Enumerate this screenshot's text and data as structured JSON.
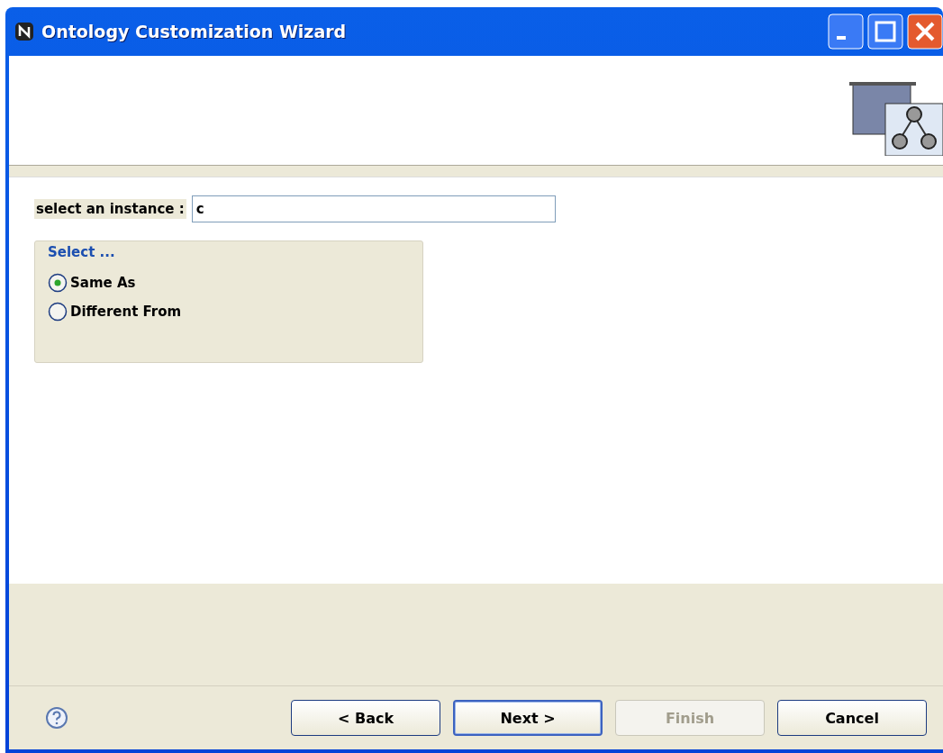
{
  "window": {
    "title": "Ontology Customization Wizard"
  },
  "instance_field": {
    "label": "select an instance :",
    "value": "c"
  },
  "group": {
    "title": "Select ...",
    "options": [
      {
        "label": "Same As",
        "selected": true
      },
      {
        "label": "Different From",
        "selected": false
      }
    ]
  },
  "buttons": [
    {
      "label": "< Back",
      "disabled": false,
      "default": false
    },
    {
      "label": "Next >",
      "disabled": false,
      "default": true
    },
    {
      "label": "Finish",
      "disabled": true,
      "default": false
    },
    {
      "label": "Cancel",
      "disabled": false,
      "default": false
    }
  ]
}
